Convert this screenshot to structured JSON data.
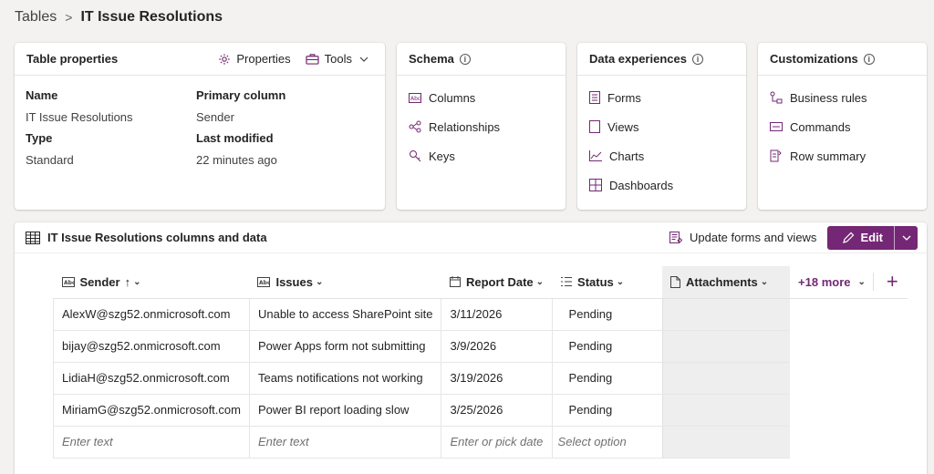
{
  "breadcrumb": {
    "root": "Tables",
    "separator": ">",
    "current": "IT Issue Resolutions"
  },
  "table_properties": {
    "title": "Table properties",
    "properties_label": "Properties",
    "tools_label": "Tools",
    "name_label": "Name",
    "name_value": "IT Issue Resolutions",
    "primary_label": "Primary column",
    "primary_value": "Sender",
    "type_label": "Type",
    "type_value": "Standard",
    "modified_label": "Last modified",
    "modified_value": "22 minutes ago"
  },
  "schema": {
    "title": "Schema",
    "items": [
      "Columns",
      "Relationships",
      "Keys"
    ]
  },
  "data_experiences": {
    "title": "Data experiences",
    "items": [
      "Forms",
      "Views",
      "Charts",
      "Dashboards"
    ]
  },
  "customizations": {
    "title": "Customizations",
    "items": [
      "Business rules",
      "Commands",
      "Row summary"
    ]
  },
  "data_section": {
    "title": "IT Issue Resolutions columns and data",
    "update_label": "Update forms and views",
    "edit_label": "Edit"
  },
  "grid": {
    "columns": [
      "Sender",
      "Issues",
      "Report Date",
      "Status",
      "Attachments"
    ],
    "sort_indicator": "↑",
    "more_label": "+18 more",
    "add_label": "+",
    "rows": [
      [
        "AlexW@szg52.onmicrosoft.com",
        "Unable to access SharePoint site",
        "3/11/2026",
        "Pending"
      ],
      [
        "bijay@szg52.onmicrosoft.com",
        "Power Apps form not submitting",
        "3/9/2026",
        "Pending"
      ],
      [
        "LidiaH@szg52.onmicrosoft.com",
        "Teams notifications not working",
        "3/19/2026",
        "Pending"
      ],
      [
        "MiriamG@szg52.onmicrosoft.com",
        "Power BI report loading slow",
        "3/25/2026",
        "Pending"
      ]
    ],
    "placeholders": [
      "Enter text",
      "Enter text",
      "Enter or pick date",
      "Select option"
    ]
  },
  "colors": {
    "accent": "#742774",
    "icon": "#742774"
  }
}
